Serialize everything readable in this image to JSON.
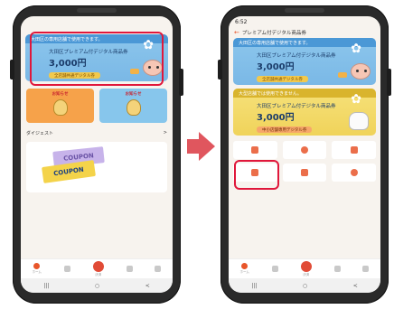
{
  "colors": {
    "accent": "#e8552a",
    "highlight": "#e0173b",
    "arrow": "#e0565e",
    "voucher_blue": "#7ab8e6",
    "voucher_yellow": "#f0d35a"
  },
  "left_phone": {
    "status": {
      "time": "",
      "icons": ""
    },
    "voucher": {
      "header": "大田区の専用店舗で使用できます。",
      "name": "大田区プレミアム付デジタル商品券",
      "amount": "3,000円",
      "sub": "",
      "tag": "全店舗共通デジタル券"
    },
    "mini_cards": [
      {
        "label": "お知らせ",
        "caption": ""
      },
      {
        "label": "お知らせ",
        "caption": ""
      }
    ],
    "section_title": "ダイジェスト",
    "section_link": ">",
    "coupon_top": "COUPON",
    "coupon_bottom": "COUPON",
    "nav": [
      {
        "label": "ホーム"
      },
      {
        "label": ""
      },
      {
        "label": "決済"
      },
      {
        "label": ""
      },
      {
        "label": ""
      }
    ],
    "sysnav": [
      "|||",
      "○",
      "<"
    ]
  },
  "right_phone": {
    "status": {
      "time": "6:52",
      "icons": ""
    },
    "title": "プレミアム付デジタル商品券",
    "back_icon": "←",
    "voucher_blue": {
      "header": "大田区の専用店舗で使用できます。",
      "name": "大田区プレミアム付デジタル商品券",
      "amount": "3,000円",
      "sub": "",
      "tag": "全店舗共通デジタル券"
    },
    "voucher_yellow": {
      "header": "大型店舗では使用できません。",
      "name": "大田区プレミアム付デジタル商品券",
      "amount": "3,000円",
      "sub": "",
      "tag": "中小店舗専用デジタル券"
    },
    "grid": [
      {
        "icon": "pay-icon",
        "caption": ""
      },
      {
        "icon": "coin-icon",
        "caption": ""
      },
      {
        "icon": "charge-icon",
        "caption": ""
      },
      {
        "icon": "qr-icon",
        "caption": ""
      },
      {
        "icon": "transfer-icon",
        "caption": ""
      },
      {
        "icon": "history-icon",
        "caption": ""
      }
    ],
    "nav": [
      {
        "label": "ホーム"
      },
      {
        "label": ""
      },
      {
        "label": "決済"
      },
      {
        "label": ""
      },
      {
        "label": ""
      }
    ],
    "sysnav": [
      "|||",
      "○",
      "<"
    ]
  }
}
